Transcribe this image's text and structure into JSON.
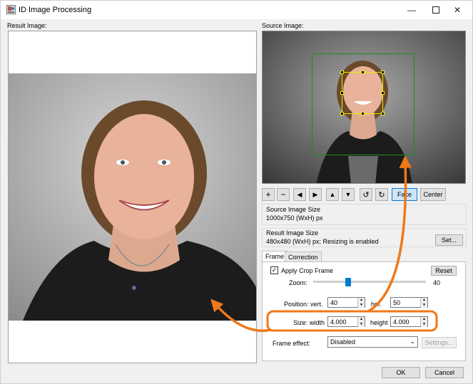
{
  "window": {
    "title": "ID Image Processing"
  },
  "labels": {
    "result_image": "Result Image:",
    "source_image": "Source Image:"
  },
  "toolbar": {
    "zoom_in": "+",
    "zoom_out": "−",
    "move_left": "◀",
    "move_right": "▶",
    "move_up": "▲",
    "move_down": "▼",
    "rotate_left": "↺",
    "rotate_right": "↻",
    "face_label": "Face",
    "center_label": "Center"
  },
  "source_size": {
    "title": "Source Image Size",
    "value": "1000x750 (WxH) px"
  },
  "result_size": {
    "title": "Result Image Size",
    "value": "480x480 (WxH) px; Resizing is enabled",
    "set_label": "Set..."
  },
  "tabs": [
    {
      "label": "Frame"
    },
    {
      "label": "Correction"
    }
  ],
  "frame": {
    "apply_crop_label": "Apply Crop Frame",
    "apply_crop_checked": true,
    "reset_label": "Reset",
    "zoom_label": "Zoom:",
    "zoom_value": "40",
    "zoom_level": 0.3,
    "position_label": "Position:",
    "vert_label": "vert.",
    "vert_value": "40",
    "hor_label": "hor.",
    "hor_value": "50",
    "size_label": "Size:",
    "width_label": "width",
    "width_value": "4.000",
    "height_label": "height",
    "height_value": "4.000",
    "effect_label": "Frame effect:",
    "effect_value": "Disabled",
    "settings_label": "Settings..."
  },
  "footer": {
    "ok_label": "OK",
    "cancel_label": "Cancel"
  },
  "colors": {
    "accent": "#f07818",
    "face_box": "#e8e800",
    "crop_box": "#1e8c1e"
  }
}
